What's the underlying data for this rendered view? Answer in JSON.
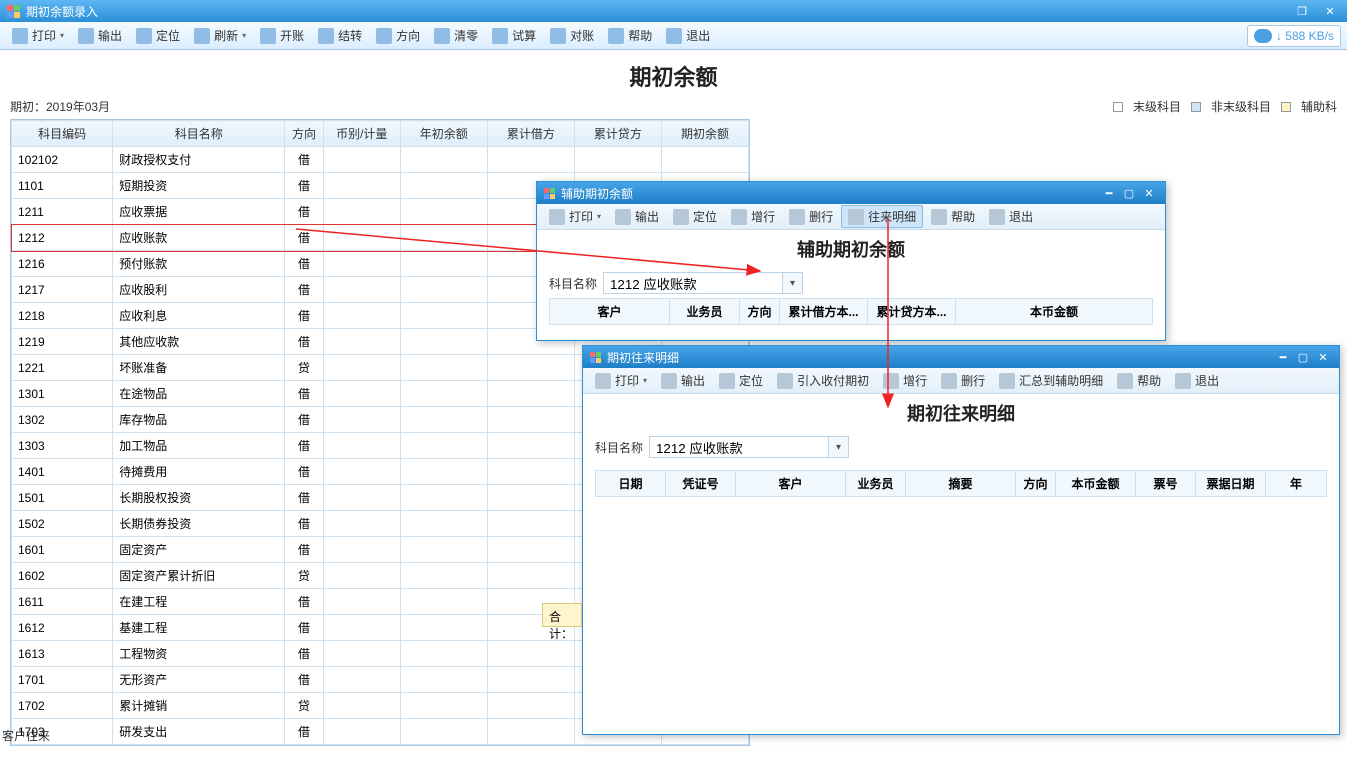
{
  "main_window": {
    "title": "期初余额录入",
    "speed": "↓ 588 KB/s"
  },
  "toolbar": {
    "print": "打印",
    "output": "输出",
    "locate": "定位",
    "refresh": "刷新",
    "open": "开账",
    "settle": "结转",
    "direction": "方向",
    "clear": "清零",
    "trial": "试算",
    "recon": "对账",
    "help": "帮助",
    "exit": "退出"
  },
  "page_title": "期初余额",
  "period_label": "期初：2019年03月",
  "legend": {
    "leaf": "末级科目",
    "nonleaf": "非末级科目",
    "aux": "辅助科"
  },
  "columns": {
    "code": "科目编码",
    "name": "科目名称",
    "dir": "方向",
    "cur": "币别/计量",
    "ybal": "年初余额",
    "dacc": "累计借方",
    "cacc": "累计贷方",
    "pbal": "期初余额"
  },
  "rows": [
    {
      "code": "102102",
      "name": "财政授权支付",
      "dir": "借"
    },
    {
      "code": "1101",
      "name": "短期投资",
      "dir": "借"
    },
    {
      "code": "1211",
      "name": "应收票据",
      "dir": "借"
    },
    {
      "code": "1212",
      "name": "应收账款",
      "dir": "借",
      "hl": true
    },
    {
      "code": "1216",
      "name": "预付账款",
      "dir": "借"
    },
    {
      "code": "1217",
      "name": "应收股利",
      "dir": "借"
    },
    {
      "code": "1218",
      "name": "应收利息",
      "dir": "借"
    },
    {
      "code": "1219",
      "name": "其他应收款",
      "dir": "借"
    },
    {
      "code": "1221",
      "name": "坏账准备",
      "dir": "贷"
    },
    {
      "code": "1301",
      "name": "在途物品",
      "dir": "借"
    },
    {
      "code": "1302",
      "name": "库存物品",
      "dir": "借"
    },
    {
      "code": "1303",
      "name": "加工物品",
      "dir": "借"
    },
    {
      "code": "1401",
      "name": "待摊费用",
      "dir": "借"
    },
    {
      "code": "1501",
      "name": "长期股权投资",
      "dir": "借"
    },
    {
      "code": "1502",
      "name": "长期债券投资",
      "dir": "借"
    },
    {
      "code": "1601",
      "name": "固定资产",
      "dir": "借"
    },
    {
      "code": "1602",
      "name": "固定资产累计折旧",
      "dir": "贷"
    },
    {
      "code": "1611",
      "name": "在建工程",
      "dir": "借"
    },
    {
      "code": "1612",
      "name": "基建工程",
      "dir": "借"
    },
    {
      "code": "1613",
      "name": "工程物资",
      "dir": "借"
    },
    {
      "code": "1701",
      "name": "无形资产",
      "dir": "借"
    },
    {
      "code": "1702",
      "name": "累计摊销",
      "dir": "贷"
    },
    {
      "code": "1703",
      "name": "研发支出",
      "dir": "借"
    }
  ],
  "total_label": "合计：",
  "dlg_aux": {
    "title": "辅助期初余额",
    "body_title": "辅助期初余额",
    "tb": {
      "print": "打印",
      "output": "输出",
      "locate": "定位",
      "addrow": "增行",
      "delrow": "删行",
      "detail": "往来明细",
      "help": "帮助",
      "exit": "退出"
    },
    "subject_label": "科目名称",
    "subject_value": "1212 应收账款",
    "cols": {
      "cust": "客户",
      "sales": "业务员",
      "dir": "方向",
      "dacc": "累计借方本...",
      "cacc": "累计贷方本...",
      "amt": "本币金额"
    }
  },
  "dlg_detail": {
    "title": "期初往来明细",
    "body_title": "期初往来明细",
    "tb": {
      "print": "打印",
      "output": "输出",
      "locate": "定位",
      "import": "引入收付期初",
      "addrow": "增行",
      "delrow": "删行",
      "summary": "汇总到辅助明细",
      "help": "帮助",
      "exit": "退出"
    },
    "subject_label": "科目名称",
    "subject_value": "1212 应收账款",
    "cols": {
      "date": "日期",
      "voucher": "凭证号",
      "cust": "客户",
      "sales": "业务员",
      "digest": "摘要",
      "dir": "方向",
      "amt": "本币金额",
      "ticket": "票号",
      "tdate": "票据日期",
      "year": "年"
    }
  },
  "status_text": "客户往来"
}
